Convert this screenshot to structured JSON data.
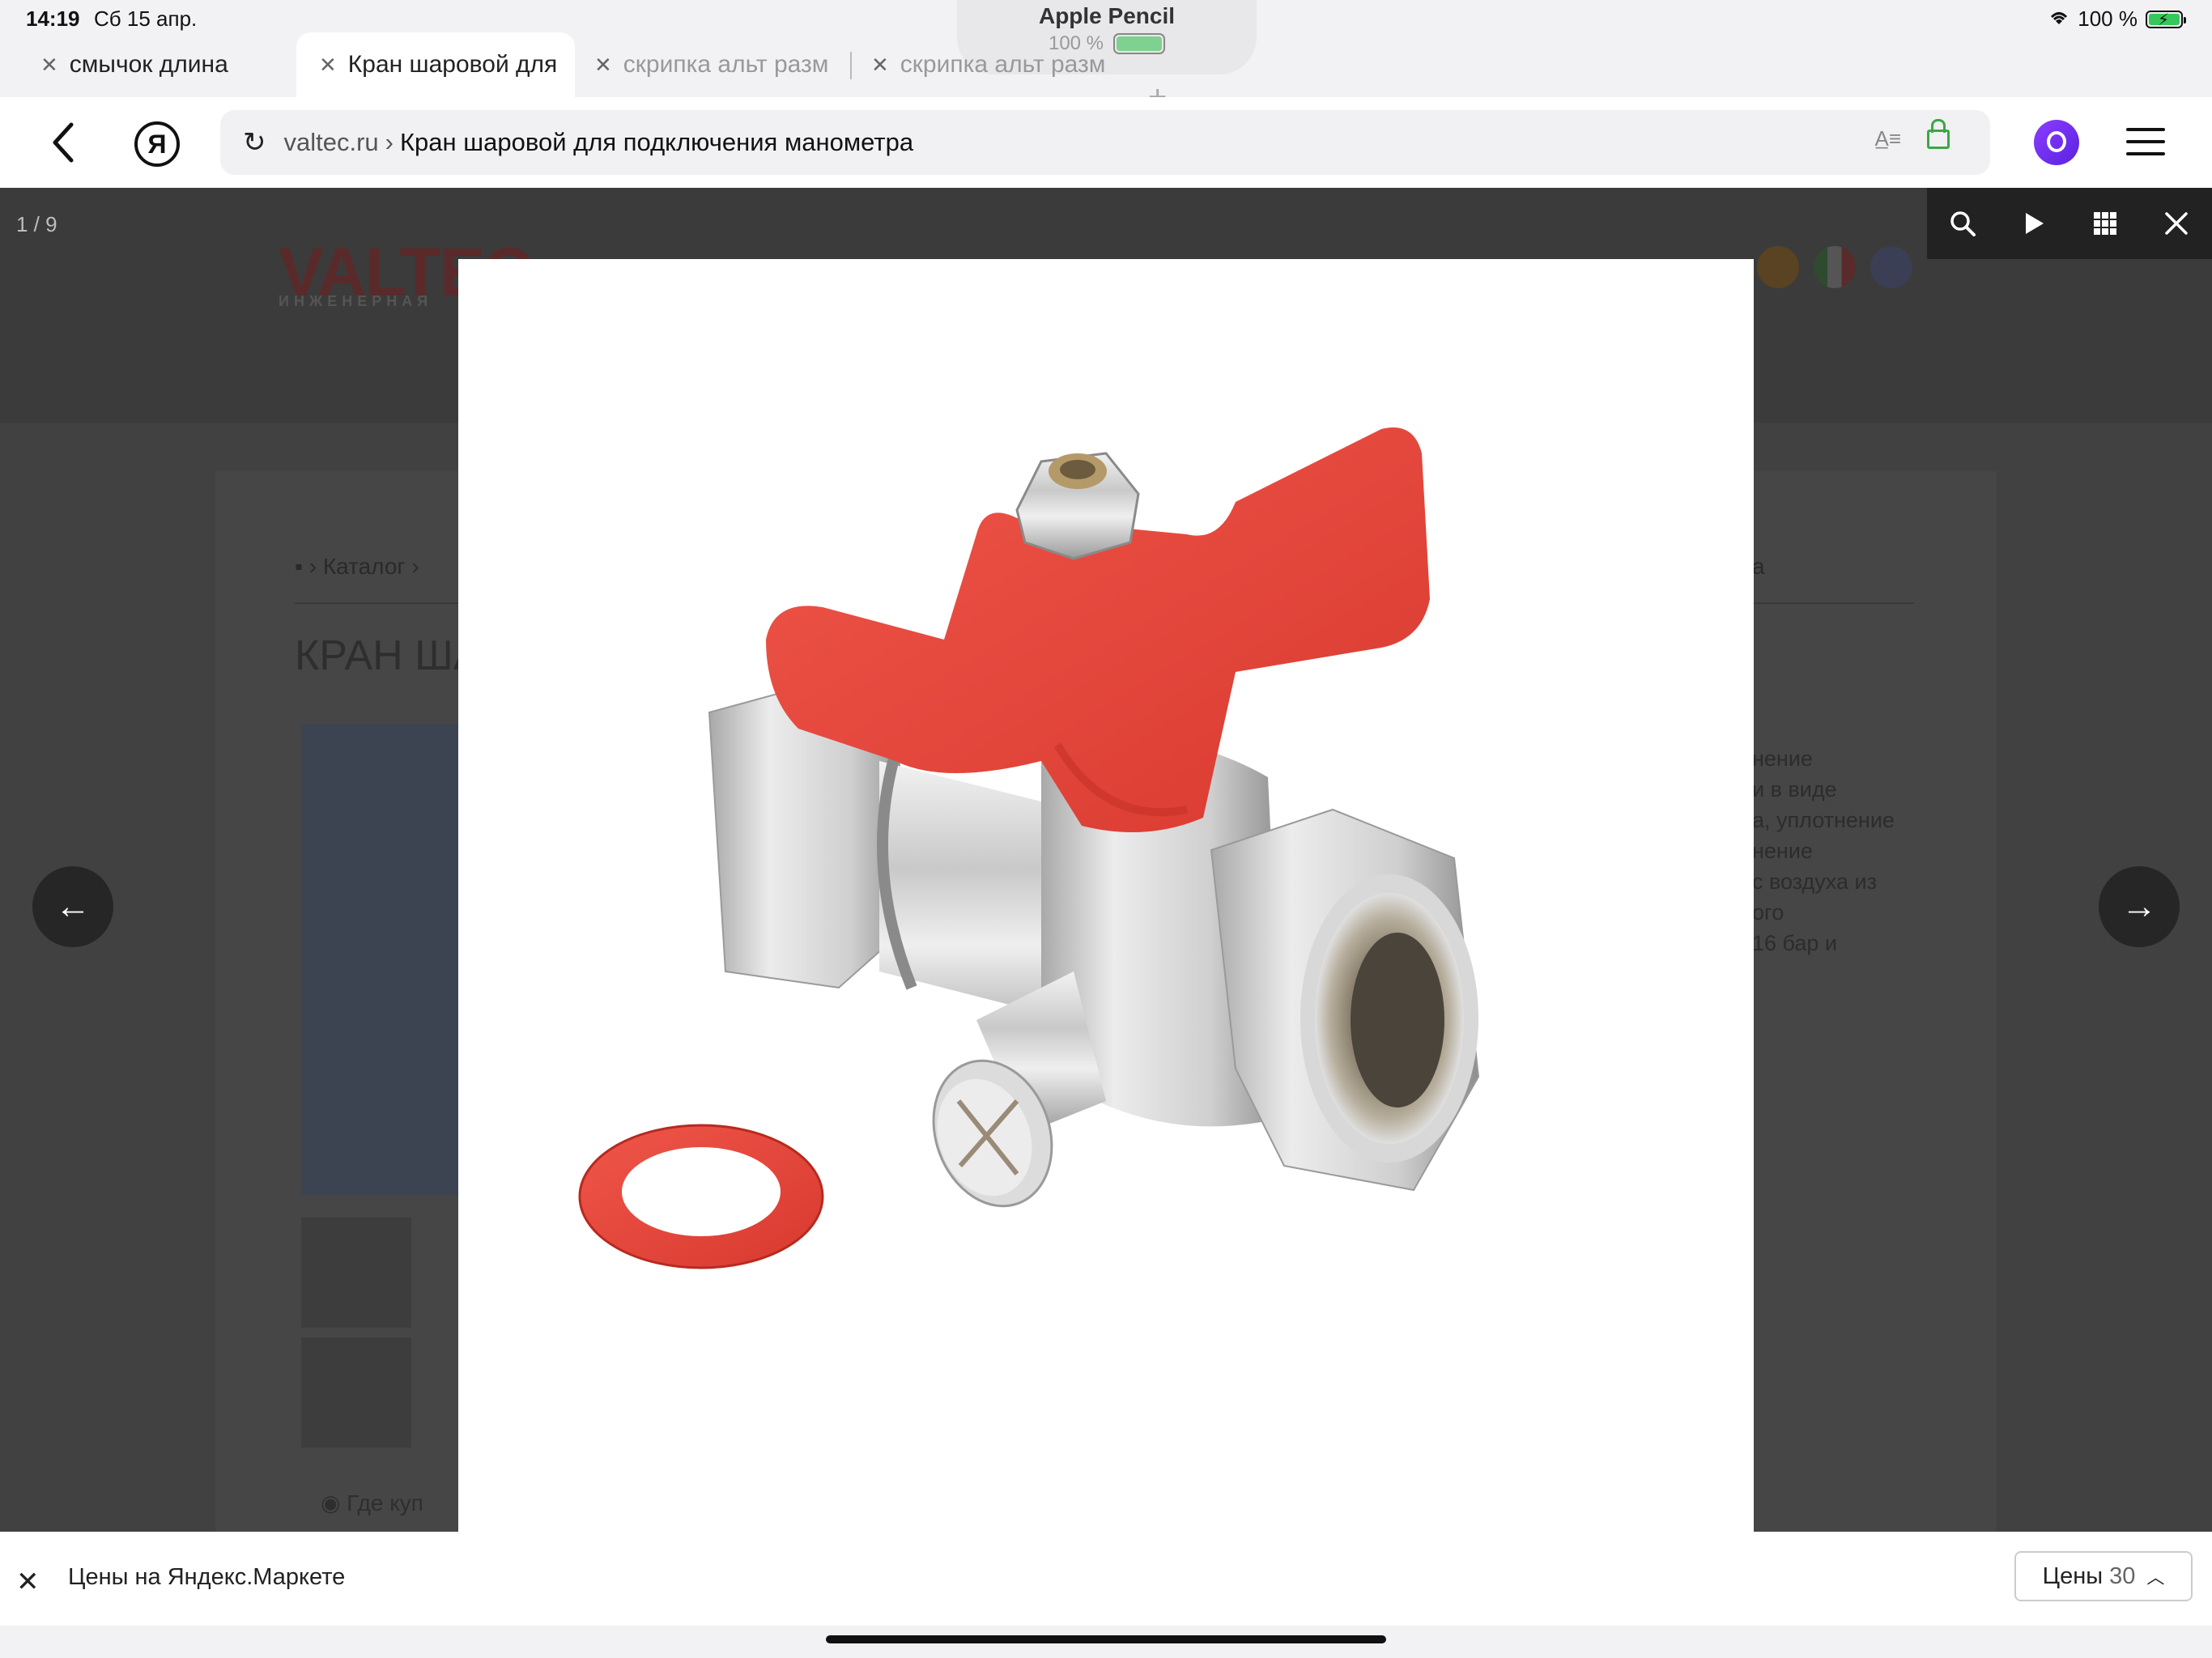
{
  "status": {
    "time": "14:19",
    "date": "Сб 15 апр.",
    "battery": "100 %",
    "battery_level": 1.0
  },
  "pencil": {
    "title": "Apple Pencil",
    "battery": "100 %"
  },
  "tabs": [
    {
      "label": "смычок длина",
      "active": false
    },
    {
      "label": "Кран шаровой для",
      "active": true
    },
    {
      "label": "скрипка альт разм",
      "active": false
    },
    {
      "label": "скрипка альт разм",
      "active": false
    }
  ],
  "address": {
    "domain": "valtec.ru",
    "separator": "›",
    "title": "Кран шаровой для подключения манометра"
  },
  "lightbox": {
    "counter": "1 / 9",
    "prev_arrow": "←",
    "next_arrow": "→"
  },
  "background_page": {
    "logo": "VALTEC",
    "logo_sub": "ИНЖЕНЕРНАЯ",
    "breadcrumb": "Каталог",
    "breadcrumb_end": "а",
    "heading": "КРАН ША",
    "description": "нение\nи в виде\nа, уплотнение\nнение\nс воздуха из\nого\n16 бар и",
    "where_to_buy": "Где куп"
  },
  "bottom_bar": {
    "label": "Цены на Яндекс.Маркете",
    "button_label": "Цены",
    "button_count": "30"
  },
  "colors": {
    "handle_red": "#e8473c",
    "gasket_red": "#dd3b2c",
    "chrome": "#d4d4d4",
    "lightbox_bg": "#414141",
    "alice_purple": "#6a2ff0"
  }
}
